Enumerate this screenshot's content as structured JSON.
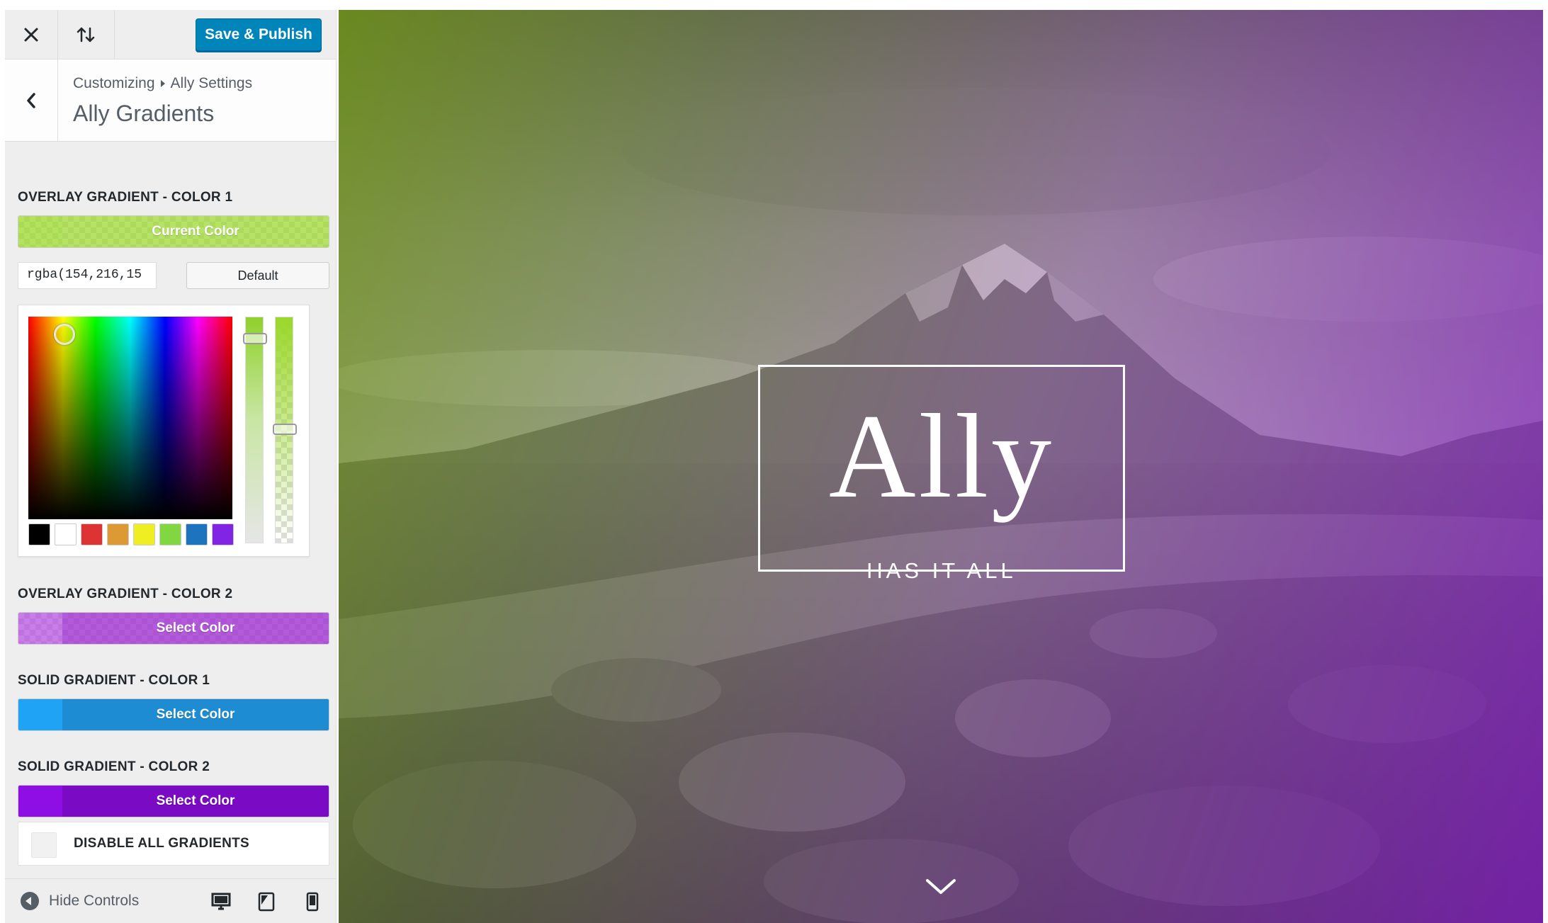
{
  "toolbar": {
    "close_icon": "close-icon",
    "sort_icon": "sort-arrows-icon",
    "publish_label": "Save & Publish"
  },
  "header": {
    "crumb_root": "Customizing",
    "crumb_current": "Ally Settings",
    "title": "Ally Gradients"
  },
  "controls": {
    "overlay_color_1": {
      "label": "OVERLAY GRADIENT - COLOR 1",
      "button_text": "Current Color",
      "color": "rgba(154,216,41,0.75)",
      "hex_value": "rgba(154,216,15",
      "default_label": "Default"
    },
    "picker": {
      "palette": [
        "#000000",
        "#ffffff",
        "#dd3333",
        "#dd9933",
        "#eeee22",
        "#81d742",
        "#1e73be",
        "#8224e3"
      ]
    },
    "overlay_color_2": {
      "label": "OVERLAY GRADIENT - COLOR 2",
      "button_text": "Select Color",
      "color": "#b146e0"
    },
    "solid_color_1": {
      "label": "SOLID GRADIENT - COLOR 1",
      "button_text": "Select Color",
      "color": "#1e8cd2",
      "swatch": "#1fa3f5"
    },
    "solid_color_2": {
      "label": "SOLID GRADIENT - COLOR 2",
      "button_text": "Select Color",
      "color": "#7a0ac4",
      "swatch": "#8f0ee6"
    },
    "disable_label": "DISABLE ALL GRADIENTS"
  },
  "footer": {
    "hide_label": "Hide Controls",
    "devices": [
      "desktop-icon",
      "tablet-icon",
      "mobile-icon"
    ]
  },
  "preview": {
    "logo": "Ally",
    "tagline": "HAS IT ALL",
    "scroll_icon": "chevron-down-icon"
  }
}
